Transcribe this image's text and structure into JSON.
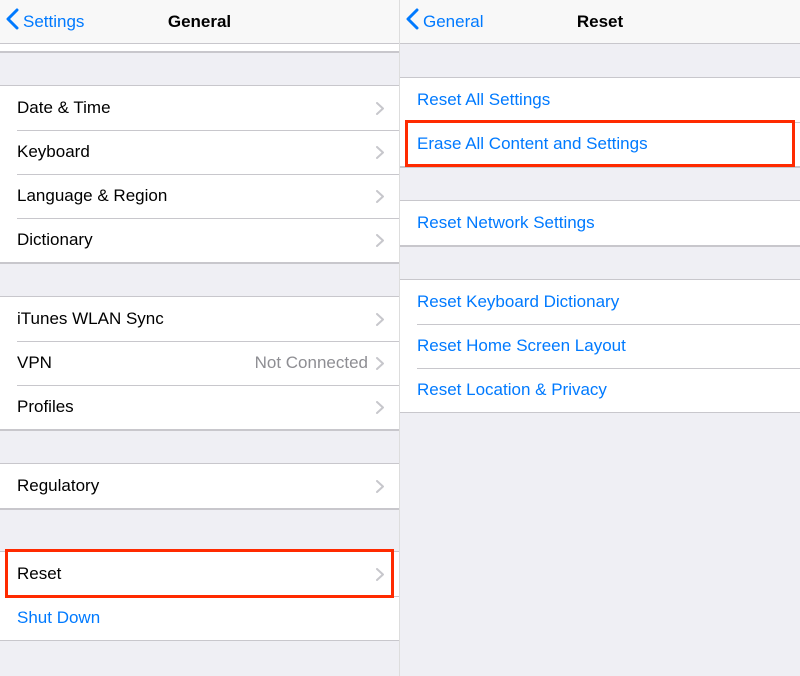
{
  "left": {
    "nav": {
      "back": "Settings",
      "title": "General"
    },
    "groups": {
      "g1": {
        "dateTime": "Date & Time",
        "keyboard": "Keyboard",
        "langRegion": "Language & Region",
        "dictionary": "Dictionary"
      },
      "g2": {
        "itunesWlan": "iTunes WLAN Sync",
        "vpn": "VPN",
        "vpnStatus": "Not Connected",
        "profiles": "Profiles"
      },
      "g3": {
        "regulatory": "Regulatory"
      },
      "g4": {
        "reset": "Reset",
        "shutDown": "Shut Down"
      }
    }
  },
  "right": {
    "nav": {
      "back": "General",
      "title": "Reset"
    },
    "groups": {
      "g1": {
        "resetAll": "Reset All Settings",
        "eraseAll": "Erase All Content and Settings"
      },
      "g2": {
        "resetNetwork": "Reset Network Settings"
      },
      "g3": {
        "resetKeyboard": "Reset Keyboard Dictionary",
        "resetHome": "Reset Home Screen Layout",
        "resetLocation": "Reset Location & Privacy"
      }
    }
  }
}
